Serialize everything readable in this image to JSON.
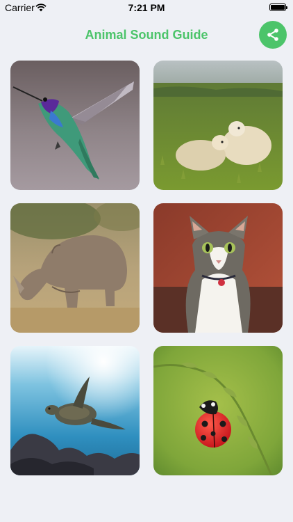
{
  "status_bar": {
    "carrier": "Carrier",
    "time": "7:21 PM",
    "battery_level": 1.0
  },
  "header": {
    "title": "Animal Sound Guide",
    "share_icon": "share-icon"
  },
  "colors": {
    "accent": "#4cc46a",
    "background": "#eef0f5"
  },
  "animals": [
    {
      "name": "hummingbird",
      "icon": "hummingbird-icon"
    },
    {
      "name": "sheep",
      "icon": "sheep-icon"
    },
    {
      "name": "rhino",
      "icon": "rhino-icon"
    },
    {
      "name": "cat",
      "icon": "cat-icon"
    },
    {
      "name": "sea-turtle",
      "icon": "turtle-icon"
    },
    {
      "name": "ladybug",
      "icon": "ladybug-icon"
    }
  ]
}
